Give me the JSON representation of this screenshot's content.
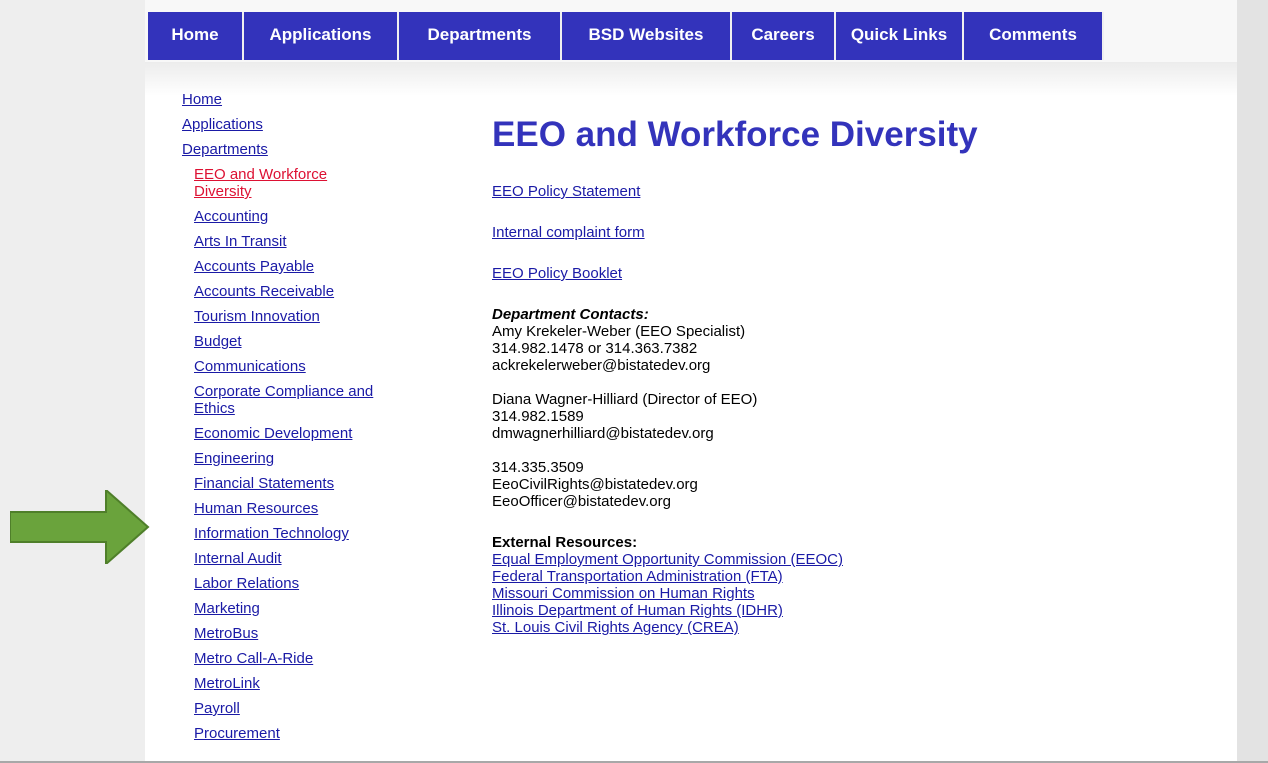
{
  "topnav": {
    "items": [
      "Home",
      "Applications",
      "Departments",
      "BSD Websites",
      "Careers",
      "Quick Links",
      "Comments"
    ]
  },
  "sidebar": {
    "top_items": [
      "Home",
      "Applications",
      "Departments"
    ],
    "departments": [
      "EEO and Workforce Diversity",
      "Accounting",
      "Arts In Transit",
      "Accounts Payable",
      "Accounts Receivable",
      "Tourism Innovation",
      "Budget",
      "Communications",
      "Corporate Compliance and Ethics",
      "Economic Development",
      "Engineering",
      "Financial Statements",
      "Human Resources",
      "Information Technology",
      "Internal Audit",
      "Labor Relations",
      "Marketing",
      "MetroBus",
      "Metro Call-A-Ride",
      "MetroLink",
      "Payroll",
      "Procurement"
    ]
  },
  "main": {
    "title": "EEO and Workforce Diversity",
    "links": [
      "EEO Policy Statement",
      "Internal complaint form",
      "EEO Policy Booklet"
    ],
    "contacts_heading": "Department Contacts:",
    "contacts": [
      [
        "Amy Krekeler-Weber (EEO Specialist)",
        "314.982.1478 or 314.363.7382",
        "ackrekelerweber@bistatedev.org"
      ],
      [
        "Diana Wagner-Hilliard (Director of EEO)",
        "314.982.1589",
        "dmwagnerhilliard@bistatedev.org"
      ],
      [
        "314.335.3509",
        "EeoCivilRights@bistatedev.org",
        "EeoOfficer@bistatedev.org"
      ]
    ],
    "external_heading": "External Resources:",
    "external_links": [
      "Equal Employment Opportunity Commission (EEOC)",
      "Federal Transportation Administration (FTA)",
      "Missouri Commission on Human Rights",
      "Illinois Department of Human Rights (IDHR)",
      "St. Louis Civil Rights Agency (CREA)"
    ]
  },
  "colors": {
    "nav_bg": "#3333bb",
    "link": "#1a1aa6",
    "active_link": "#dd1133",
    "arrow": "#6aa33c"
  },
  "icons": {
    "annotation_arrow": "right-arrow-icon"
  }
}
